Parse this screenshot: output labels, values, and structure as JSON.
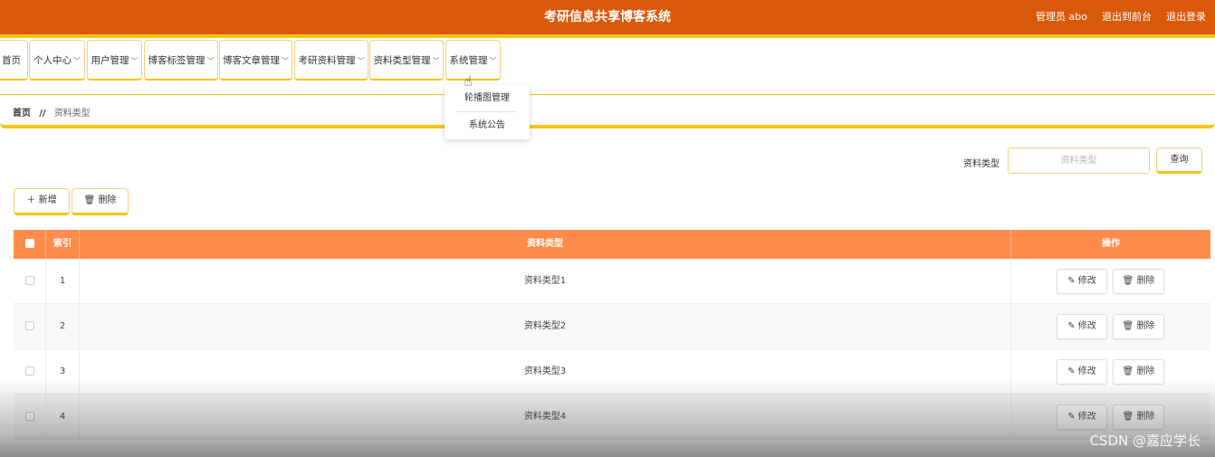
{
  "header": {
    "title": "考研信息共享博客系统",
    "user": "管理员 abo",
    "to_front": "退出到前台",
    "logout": "退出登录"
  },
  "nav": {
    "items": [
      {
        "label": "首页",
        "chevron": false
      },
      {
        "label": "个人中心",
        "chevron": true
      },
      {
        "label": "用户管理",
        "chevron": true
      },
      {
        "label": "博客标签管理",
        "chevron": true
      },
      {
        "label": "博客文章管理",
        "chevron": true
      },
      {
        "label": "考研资料管理",
        "chevron": true
      },
      {
        "label": "资料类型管理",
        "chevron": true
      },
      {
        "label": "系统管理",
        "chevron": true
      }
    ],
    "dropdown": [
      "轮播图管理",
      "系统公告"
    ]
  },
  "breadcrumb": {
    "home": "首页",
    "separator": "//",
    "current": "资料类型"
  },
  "search": {
    "label": "资料类型",
    "placeholder": "资料类型",
    "button": "查询"
  },
  "actions": {
    "add": "新增",
    "delete": "删除"
  },
  "table": {
    "headers": [
      "",
      "索引",
      "资料类型",
      "操作"
    ],
    "rows": [
      {
        "index": "1",
        "type": "资料类型1"
      },
      {
        "index": "2",
        "type": "资料类型2"
      },
      {
        "index": "3",
        "type": "资料类型3"
      },
      {
        "index": "4",
        "type": "资料类型4"
      }
    ],
    "edit_label": "修改",
    "delete_label": "删除"
  },
  "watermark": "CSDN @嘉应学长",
  "colors": {
    "header_bg": "#d9590b",
    "accent_yellow": "#f5c518",
    "table_header_bg": "#ff8c4a"
  }
}
